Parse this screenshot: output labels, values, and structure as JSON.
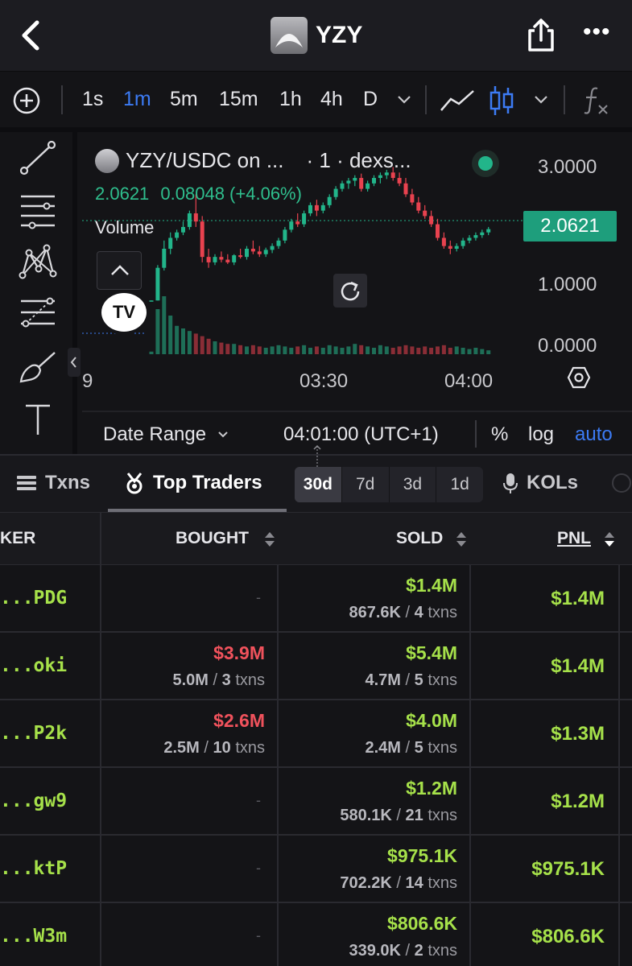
{
  "header": {
    "title": "YZY",
    "more": "•••"
  },
  "timeframes": {
    "options": [
      "1s",
      "1m",
      "5m",
      "15m",
      "1h",
      "4h",
      "D"
    ],
    "selected": "1m"
  },
  "chart": {
    "pair": "YZY/USDC on ...",
    "source": "· 1 · dexs...",
    "price": "2.0621",
    "change": "0.08048 (+4.06%)",
    "volume_label": "Volume",
    "current_price_tag": "2.0621",
    "y_ticks": [
      "3.0000",
      "1.0000",
      "0.0000"
    ],
    "x_ticks": [
      "9",
      "03:30",
      "04:00"
    ],
    "tv_logo": "TV",
    "date_range": "Date Range",
    "time": "04:01:00 (UTC+1)",
    "pct": "%",
    "log": "log",
    "auto": "auto",
    "colors": {
      "up": "#22b58a",
      "down": "#e8424f",
      "accent": "#3c7bf4"
    }
  },
  "chart_data": {
    "type": "candlestick",
    "title": "YZY/USDC",
    "ylim": [
      0,
      3.4
    ],
    "x_ticks": [
      "03:30",
      "04:00"
    ],
    "series": [
      {
        "name": "YZY/USDC",
        "ohlc": [
          [
            0.75,
            0.75,
            0.74,
            0.75
          ],
          [
            0.75,
            1.4,
            0.75,
            1.35
          ],
          [
            1.35,
            1.85,
            1.3,
            1.7
          ],
          [
            1.7,
            2.0,
            1.6,
            1.9
          ],
          [
            1.9,
            2.05,
            1.85,
            2.0
          ],
          [
            2.0,
            2.2,
            1.95,
            2.1
          ],
          [
            2.1,
            2.4,
            2.05,
            2.35
          ],
          [
            2.35,
            2.7,
            2.1,
            2.2
          ],
          [
            2.2,
            2.3,
            1.45,
            1.55
          ],
          [
            1.55,
            1.7,
            1.35,
            1.45
          ],
          [
            1.45,
            1.6,
            1.4,
            1.55
          ],
          [
            1.55,
            1.65,
            1.45,
            1.5
          ],
          [
            1.5,
            1.6,
            1.42,
            1.45
          ],
          [
            1.45,
            1.6,
            1.4,
            1.58
          ],
          [
            1.58,
            1.7,
            1.52,
            1.55
          ],
          [
            1.55,
            1.75,
            1.5,
            1.7
          ],
          [
            1.7,
            1.85,
            1.6,
            1.65
          ],
          [
            1.65,
            1.75,
            1.55,
            1.6
          ],
          [
            1.6,
            1.72,
            1.55,
            1.68
          ],
          [
            1.68,
            1.8,
            1.62,
            1.75
          ],
          [
            1.75,
            1.9,
            1.7,
            1.85
          ],
          [
            1.85,
            2.1,
            1.8,
            2.05
          ],
          [
            2.05,
            2.25,
            2.0,
            2.2
          ],
          [
            2.2,
            2.35,
            2.1,
            2.15
          ],
          [
            2.15,
            2.4,
            2.1,
            2.35
          ],
          [
            2.35,
            2.55,
            2.3,
            2.5
          ],
          [
            2.5,
            2.6,
            2.3,
            2.4
          ],
          [
            2.4,
            2.55,
            2.35,
            2.5
          ],
          [
            2.5,
            2.7,
            2.45,
            2.65
          ],
          [
            2.65,
            2.85,
            2.6,
            2.8
          ],
          [
            2.8,
            2.95,
            2.75,
            2.9
          ],
          [
            2.9,
            3.0,
            2.8,
            2.95
          ],
          [
            2.95,
            3.05,
            2.85,
            3.0
          ],
          [
            3.0,
            3.08,
            2.75,
            2.8
          ],
          [
            2.8,
            2.95,
            2.75,
            2.9
          ],
          [
            2.9,
            3.05,
            2.85,
            3.0
          ],
          [
            3.0,
            3.1,
            2.9,
            3.05
          ],
          [
            3.05,
            3.15,
            2.98,
            3.1
          ],
          [
            3.1,
            3.2,
            2.95,
            3.0
          ],
          [
            3.0,
            3.1,
            2.85,
            2.9
          ],
          [
            2.9,
            3.0,
            2.65,
            2.7
          ],
          [
            2.7,
            2.8,
            2.5,
            2.55
          ],
          [
            2.55,
            2.65,
            2.35,
            2.4
          ],
          [
            2.4,
            2.5,
            2.25,
            2.3
          ],
          [
            2.3,
            2.4,
            2.1,
            2.15
          ],
          [
            2.15,
            2.25,
            1.85,
            1.9
          ],
          [
            1.9,
            2.0,
            1.7,
            1.75
          ],
          [
            1.75,
            1.85,
            1.6,
            1.7
          ],
          [
            1.7,
            1.8,
            1.65,
            1.75
          ],
          [
            1.75,
            1.9,
            1.7,
            1.85
          ],
          [
            1.85,
            1.95,
            1.8,
            1.9
          ],
          [
            1.9,
            2.0,
            1.85,
            1.95
          ],
          [
            1.95,
            2.05,
            1.9,
            2.0
          ],
          [
            2.0,
            2.1,
            1.95,
            2.06
          ]
        ]
      }
    ],
    "volume": [
      0.02,
      0.35,
      0.45,
      0.3,
      0.22,
      0.2,
      0.18,
      0.16,
      0.14,
      0.12,
      0.1,
      0.09,
      0.08,
      0.08,
      0.07,
      0.06,
      0.07,
      0.06,
      0.05,
      0.06,
      0.07,
      0.06,
      0.05,
      0.06,
      0.07,
      0.05,
      0.06,
      0.05,
      0.07,
      0.06,
      0.05,
      0.06,
      0.08,
      0.07,
      0.06,
      0.05,
      0.07,
      0.06,
      0.05,
      0.06,
      0.07,
      0.06,
      0.05,
      0.06,
      0.05,
      0.06,
      0.07,
      0.05,
      0.06,
      0.05,
      0.04,
      0.05,
      0.04,
      0.03
    ]
  },
  "tabs": {
    "txns": "Txns",
    "top_traders": "Top Traders",
    "ranges": [
      "30d",
      "7d",
      "3d",
      "1d"
    ],
    "selected_range": "30d",
    "kols": "KOLs"
  },
  "table": {
    "headers": {
      "maker": "KER",
      "bought": "BOUGHT",
      "sold": "SOLD",
      "pnl": "PNL"
    },
    "rows": [
      {
        "maker": "...PDG",
        "bought": "-",
        "bought_tokens": "",
        "bought_txns": "",
        "sold": "$1.4M",
        "sold_tokens": "867.6K",
        "sold_txns": "4",
        "pnl": "$1.4M"
      },
      {
        "maker": "...oki",
        "bought": "$3.9M",
        "bought_tokens": "5.0M",
        "bought_txns": "3",
        "sold": "$5.4M",
        "sold_tokens": "4.7M",
        "sold_txns": "5",
        "pnl": "$1.4M"
      },
      {
        "maker": "...P2k",
        "bought": "$2.6M",
        "bought_tokens": "2.5M",
        "bought_txns": "10",
        "sold": "$4.0M",
        "sold_tokens": "2.4M",
        "sold_txns": "5",
        "pnl": "$1.3M"
      },
      {
        "maker": "...gw9",
        "bought": "-",
        "bought_tokens": "",
        "bought_txns": "",
        "sold": "$1.2M",
        "sold_tokens": "580.1K",
        "sold_txns": "21",
        "pnl": "$1.2M"
      },
      {
        "maker": "...ktP",
        "bought": "-",
        "bought_tokens": "",
        "bought_txns": "",
        "sold": "$975.1K",
        "sold_tokens": "702.2K",
        "sold_txns": "14",
        "pnl": "$975.1K"
      },
      {
        "maker": "...W3m",
        "bought": "-",
        "bought_tokens": "",
        "bought_txns": "",
        "sold": "$806.6K",
        "sold_tokens": "339.0K",
        "sold_txns": "2",
        "pnl": "$806.6K"
      }
    ],
    "txns_word": "txns"
  }
}
